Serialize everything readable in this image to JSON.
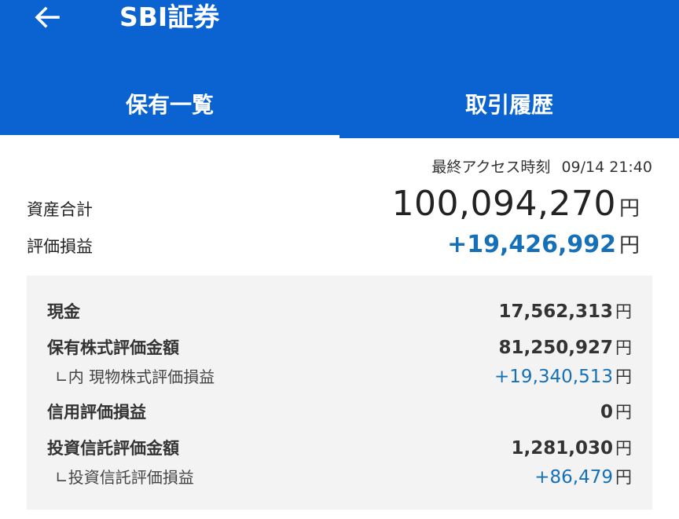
{
  "header": {
    "title": "SBI証券",
    "back_icon": "arrow-left-icon",
    "background_color": "#0a63d0"
  },
  "tabs": [
    {
      "label": "保有一覧",
      "active": true
    },
    {
      "label": "取引履歴",
      "active": false
    }
  ],
  "last_access": {
    "label": "最終アクセス時刻",
    "value": "09/14 21:40"
  },
  "summary": {
    "total_assets": {
      "label": "資産合計",
      "value": "100,094,270",
      "unit": "円"
    },
    "unrealized_pl": {
      "label": "評価損益",
      "value": "+19,426,992",
      "unit": "円",
      "color": "#1570b8"
    }
  },
  "breakdown": [
    {
      "label": "現金",
      "value": "17,562,313",
      "unit": "円",
      "sub": false
    },
    {
      "label": "保有株式評価金額",
      "value": "81,250,927",
      "unit": "円",
      "sub": false
    },
    {
      "label": "∟内 現物株式評価損益",
      "value": "+19,340,513",
      "unit": "円",
      "sub": true
    },
    {
      "label": "信用評価損益",
      "value": "0",
      "unit": "円",
      "sub": false
    },
    {
      "label": "投資信託評価金額",
      "value": "1,281,030",
      "unit": "円",
      "sub": false
    },
    {
      "label": "∟投資信託評価損益",
      "value": "+86,479",
      "unit": "円",
      "sub": true
    }
  ]
}
